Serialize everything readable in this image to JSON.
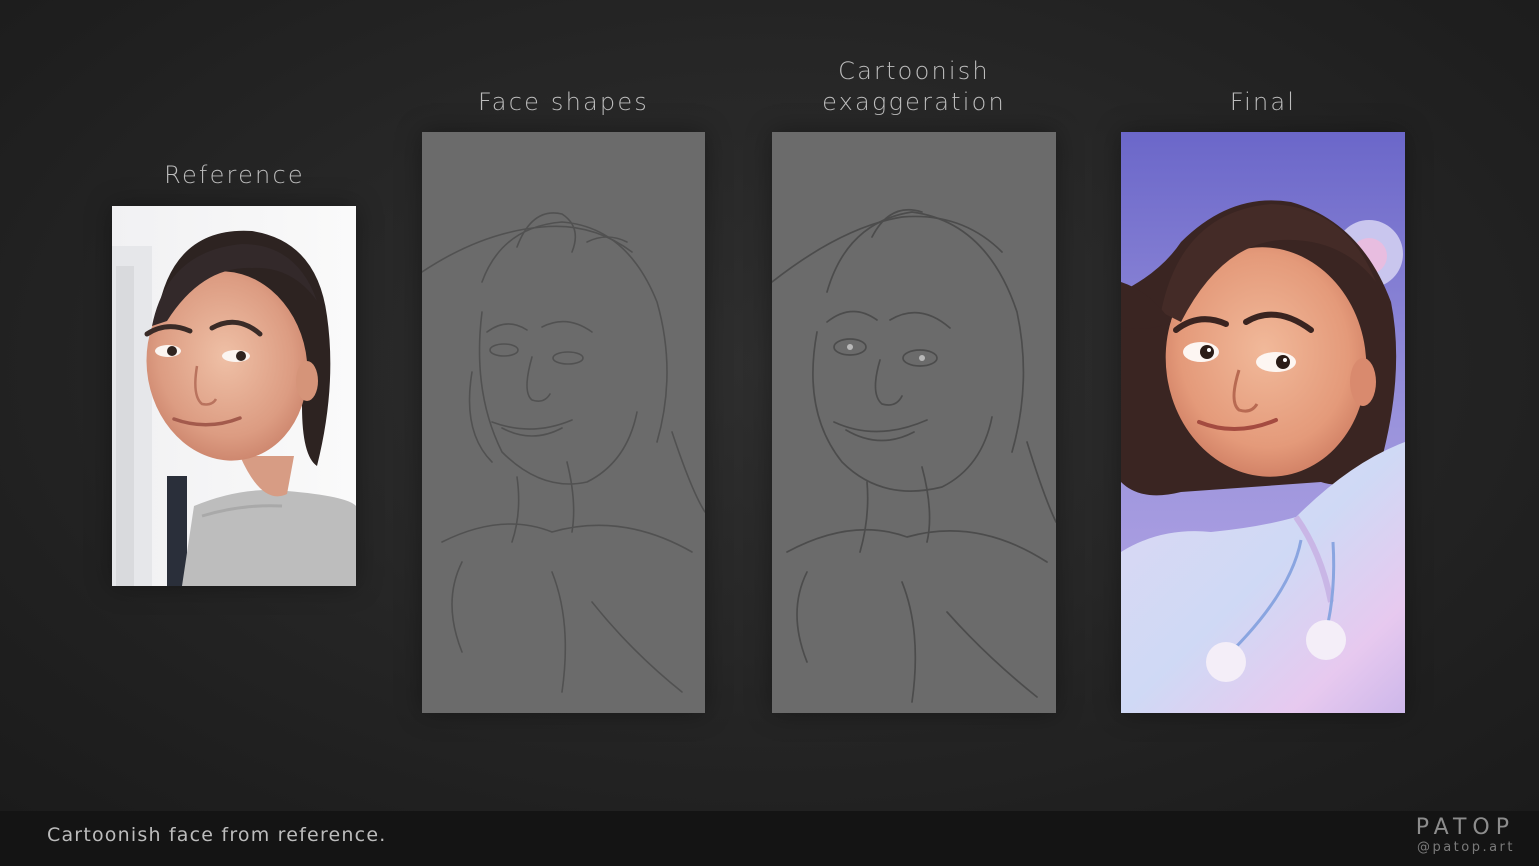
{
  "panels": {
    "reference": {
      "title": "Reference"
    },
    "face_shapes": {
      "title": "Face shapes"
    },
    "exaggeration": {
      "title_line1": "Cartoonish",
      "title_line2": "exaggeration"
    },
    "final": {
      "title": "Final"
    }
  },
  "footer": {
    "caption": "Cartoonish face from reference.",
    "brand_name": "PATOP",
    "brand_handle": "@patop.art"
  },
  "colors": {
    "background": "#262626",
    "footer_bar": "#141414",
    "title_text": "#bdbdbd",
    "sketch_paper": "#6b6b6b",
    "final_backdrop": "#8a84d6"
  }
}
